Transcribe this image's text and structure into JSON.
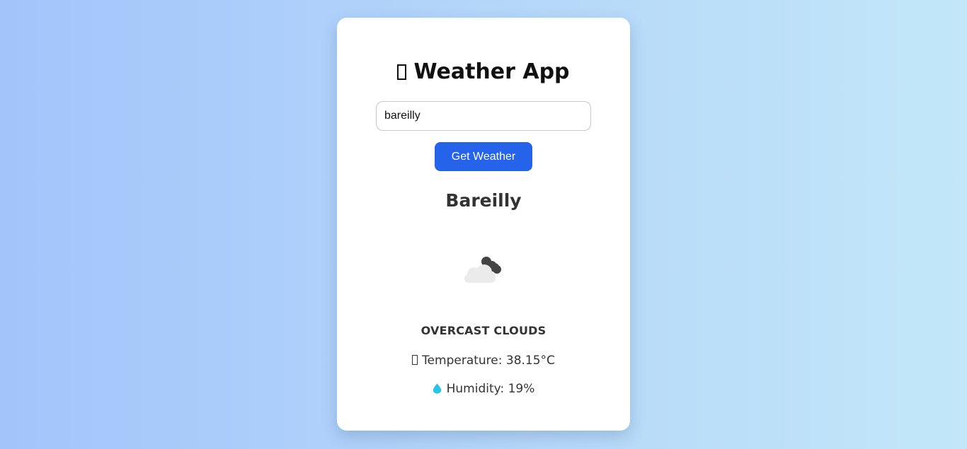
{
  "app": {
    "title": "Weather App",
    "title_icon": "weather-emoji-icon"
  },
  "search": {
    "value": "bareilly",
    "button_label": "Get Weather"
  },
  "result": {
    "city": "Bareilly",
    "icon": "overcast-clouds-icon",
    "description": "OVERCAST CLOUDS",
    "temperature_label": "Temperature:",
    "temperature_value": "38.15°C",
    "humidity_label": "Humidity:",
    "humidity_value": "19%"
  },
  "colors": {
    "background_start": "#a2c4fb",
    "background_end": "#c3e7f9",
    "button": "#2563eb",
    "drop": "#29c5e6"
  }
}
